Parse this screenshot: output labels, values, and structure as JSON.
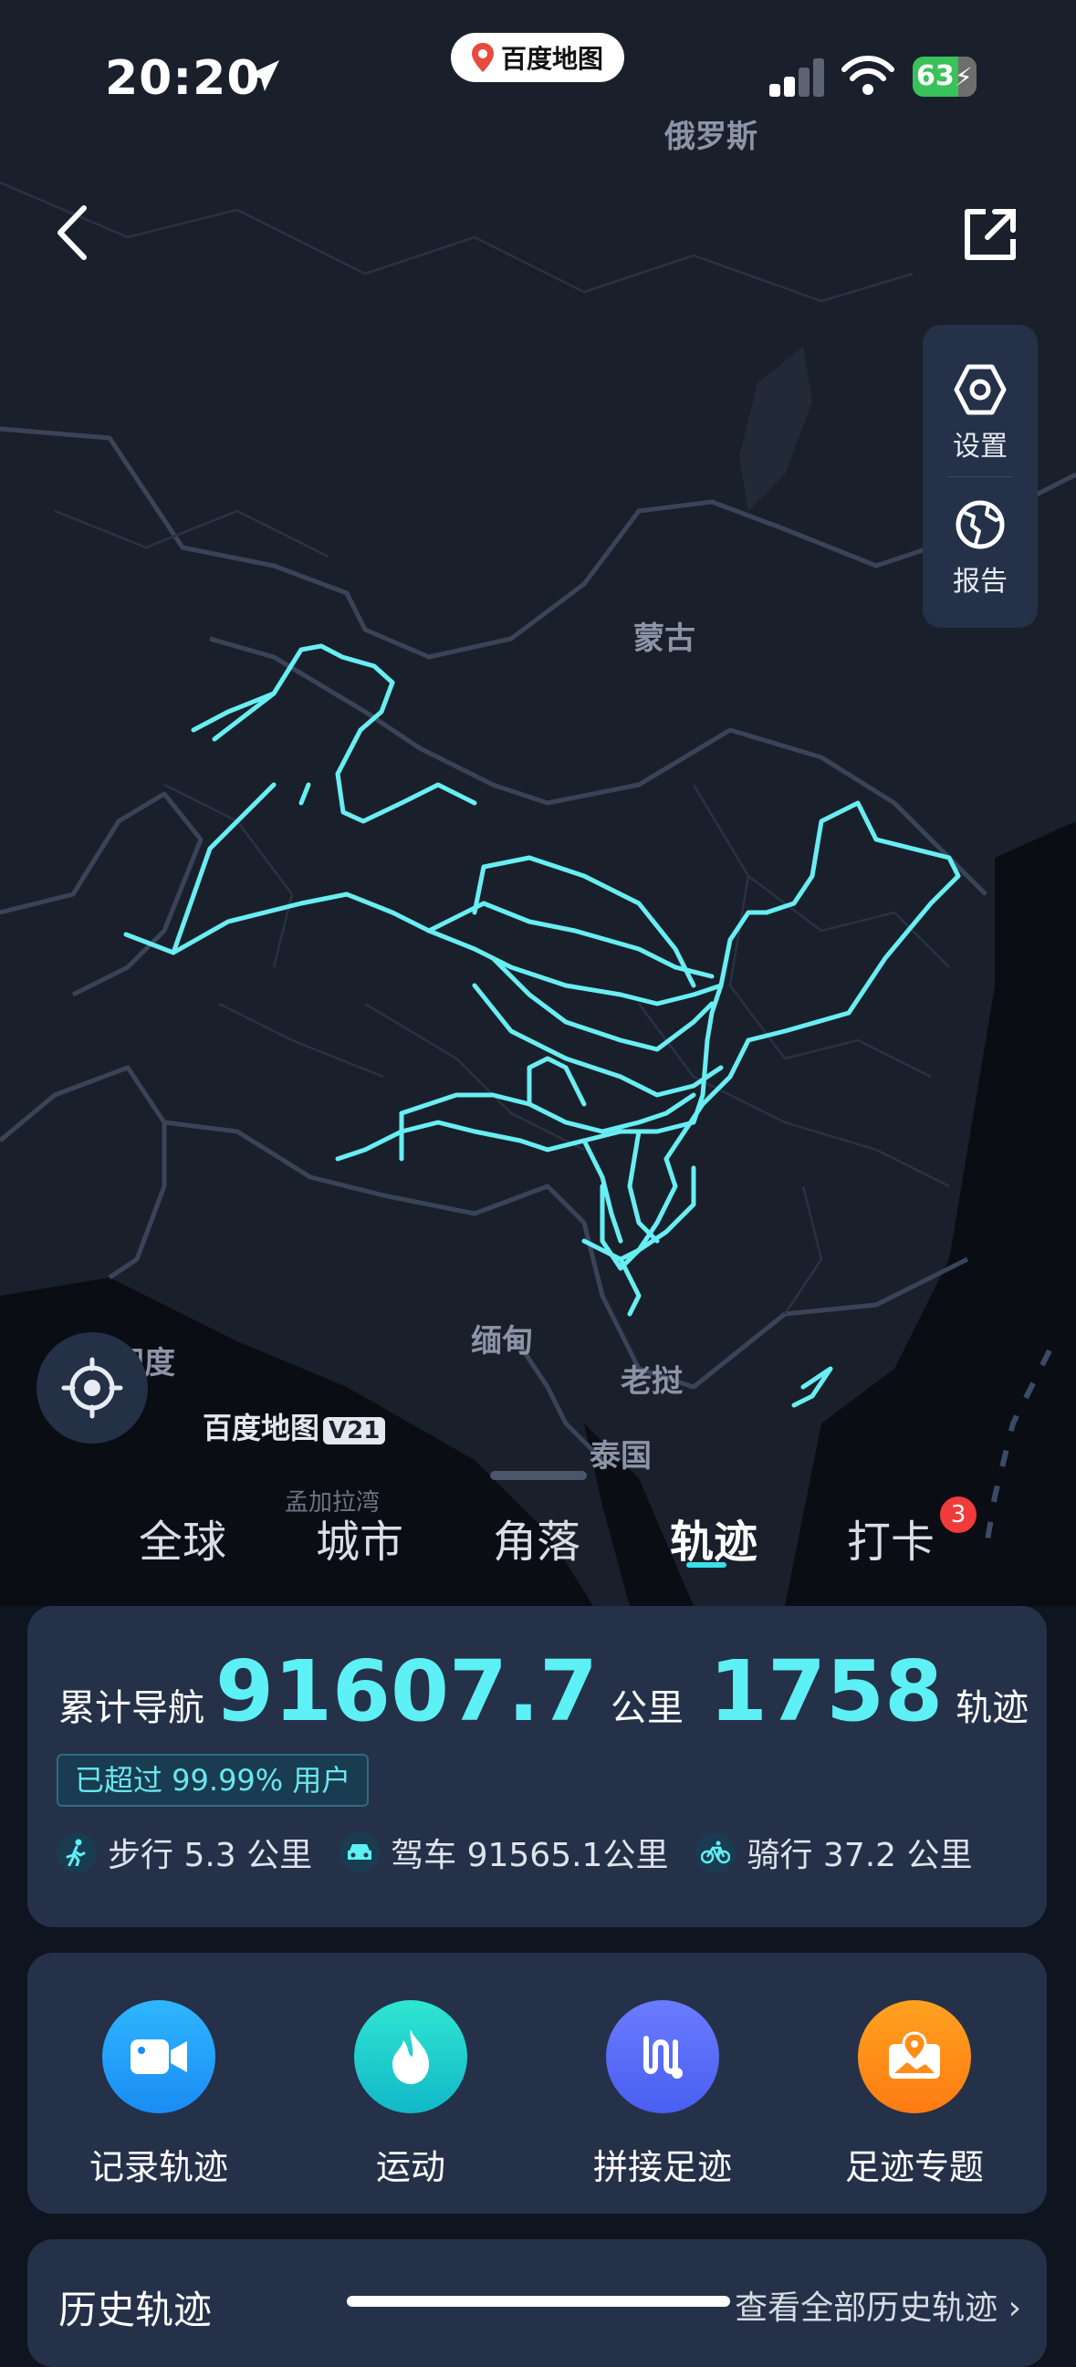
{
  "status_bar": {
    "time": "20:20",
    "battery": "63"
  },
  "app_pill": {
    "label": "百度地图"
  },
  "map": {
    "labels": {
      "russia": "俄罗斯",
      "mongolia": "蒙古",
      "myanmar": "缅甸",
      "india": "印度",
      "laos": "老挝",
      "thailand": "泰国",
      "bangladesh": "孟加拉湾"
    },
    "logo": "百度地图",
    "logo_version": "V21",
    "track_color": "#68eef3"
  },
  "side_panel": {
    "settings": "设置",
    "report": "报告"
  },
  "tabs": {
    "items": [
      "全球",
      "城市",
      "角落",
      "轨迹",
      "打卡"
    ],
    "active": "轨迹",
    "badge": "3"
  },
  "stats": {
    "nav_label": "累计导航",
    "distance": "91607.7",
    "distance_unit": "公里",
    "tracks": "1758",
    "tracks_unit": "轨迹",
    "exceed": "已超过 99.99% 用户",
    "walk": "步行 5.3 公里",
    "drive": "驾车 91565.1公里",
    "ride": "骑行 37.2 公里"
  },
  "actions": {
    "record": "记录轨迹",
    "sport": "运动",
    "stitch": "拼接足迹",
    "topic": "足迹专题"
  },
  "history": {
    "title": "历史轨迹",
    "link": "查看全部历史轨迹 ›"
  }
}
